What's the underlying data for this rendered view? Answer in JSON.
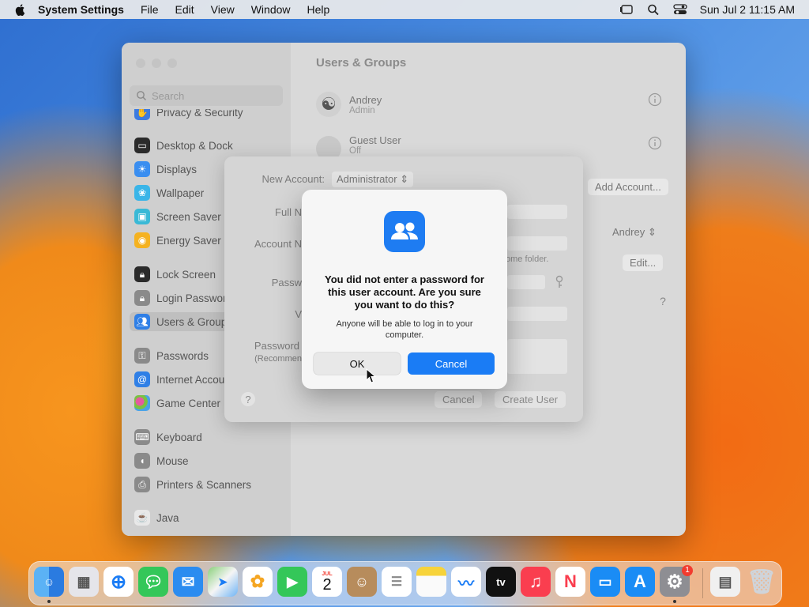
{
  "menubar": {
    "app_name": "System Settings",
    "menus": [
      "File",
      "Edit",
      "View",
      "Window",
      "Help"
    ],
    "clock": "Sun Jul 2  11:15 AM"
  },
  "window": {
    "title": "Users & Groups",
    "search_placeholder": "Search",
    "sidebar": [
      {
        "label": "Privacy & Security",
        "icon": "hand-icon",
        "color": "#3d7be0"
      },
      {
        "label": "Desktop & Dock",
        "icon": "dock-icon",
        "color": "#2b2b2b"
      },
      {
        "label": "Displays",
        "icon": "sun-icon",
        "color": "#3a8ef0"
      },
      {
        "label": "Wallpaper",
        "icon": "wallpaper-icon",
        "color": "#3ab5e8"
      },
      {
        "label": "Screen Saver",
        "icon": "screen-saver-icon",
        "color": "#39b9d6"
      },
      {
        "label": "Energy Saver",
        "icon": "bulb-icon",
        "color": "#f5b220"
      },
      {
        "label": "Lock Screen",
        "icon": "lock-icon",
        "color": "#2b2b2b"
      },
      {
        "label": "Login Password",
        "icon": "lock-icon",
        "color": "#8a8a8a"
      },
      {
        "label": "Users & Groups",
        "icon": "users-icon",
        "color": "#2f7fe6"
      },
      {
        "label": "Passwords",
        "icon": "key-icon",
        "color": "#8a8a8a"
      },
      {
        "label": "Internet Accounts",
        "icon": "at-icon",
        "color": "#2f7fe6"
      },
      {
        "label": "Game Center",
        "icon": "game-center-icon",
        "color": "#e8e8e8"
      },
      {
        "label": "Keyboard",
        "icon": "keyboard-icon",
        "color": "#8a8a8a"
      },
      {
        "label": "Mouse",
        "icon": "mouse-icon",
        "color": "#8a8a8a"
      },
      {
        "label": "Printers & Scanners",
        "icon": "printer-icon",
        "color": "#8a8a8a"
      },
      {
        "label": "Java",
        "icon": "java-icon",
        "color": "#e8e8e8"
      }
    ],
    "users": [
      {
        "name": "Andrey",
        "role": "Admin"
      },
      {
        "name": "Guest User",
        "role": "Off"
      }
    ],
    "add_account_label": "Add Account...",
    "login_user": "Andrey",
    "edit_label": "Edit..."
  },
  "sheet": {
    "new_account_label": "New Account:",
    "new_account_value": "Administrator",
    "full_name_label": "Full N",
    "account_name_label": "Account N",
    "home_folder_note": "ome folder.",
    "password_label": "Passw",
    "verify_label": "V",
    "hint_label": "Password",
    "hint_sub": "(Recommen",
    "cancel_label": "Cancel",
    "create_label": "Create User"
  },
  "alert": {
    "headline": "You did not enter a password for this user account. Are you sure you want to do this?",
    "body": "Anyone will be able to log in to your computer.",
    "ok_label": "OK",
    "cancel_label": "Cancel",
    "accent": "#1a7cf5"
  },
  "dock": {
    "apps": [
      "Finder",
      "Launchpad",
      "Safari",
      "Messages",
      "Mail",
      "Maps",
      "Photos",
      "FaceTime",
      "Calendar",
      "Contacts",
      "Reminders",
      "Notes",
      "Freeform",
      "TV",
      "Music",
      "News",
      "Keynote",
      "App Store",
      "System Settings",
      "Preview",
      "Trash"
    ],
    "calendar_month": "JUL",
    "calendar_day": "2",
    "settings_badge": "1"
  }
}
